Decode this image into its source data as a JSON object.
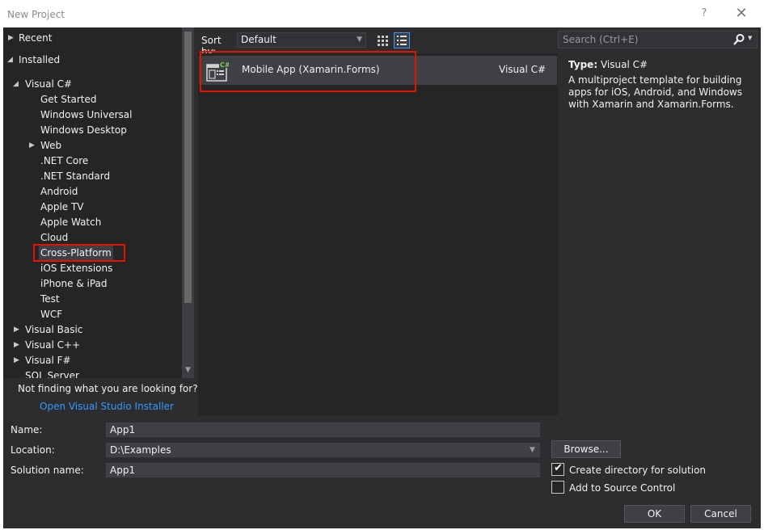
{
  "window": {
    "title": "New Project",
    "help_glyph": "?",
    "close_glyph": "✕"
  },
  "tree": {
    "recent": "Recent",
    "installed": "Installed",
    "visual_csharp": "Visual C#",
    "children": [
      "Get Started",
      "Windows Universal",
      "Windows Desktop",
      "Web",
      ".NET Core",
      ".NET Standard",
      "Android",
      "Apple TV",
      "Apple Watch",
      "Cloud",
      "Cross-Platform",
      "iOS Extensions",
      "iPhone & iPad",
      "Test",
      "WCF"
    ],
    "visual_basic": "Visual Basic",
    "visual_cpp": "Visual C++",
    "visual_fsharp": "Visual F#",
    "sql_server": "SQL Server",
    "selected": "Cross-Platform"
  },
  "help": {
    "not_finding": "Not finding what you are looking for?",
    "installer_link": "Open Visual Studio Installer"
  },
  "sort": {
    "label": "Sort by:",
    "value": "Default"
  },
  "templates": [
    {
      "name": "Mobile App (Xamarin.Forms)",
      "language": "Visual C#"
    }
  ],
  "search": {
    "placeholder": "Search (Ctrl+E)"
  },
  "details": {
    "type_label": "Type:",
    "type_value": "Visual C#",
    "description": "A multiproject template for building apps for iOS, Android, and Windows with Xamarin and Xamarin.Forms."
  },
  "form": {
    "name_label": "Name:",
    "name_value": "App1",
    "location_label": "Location:",
    "location_value": "D:\\Examples",
    "solution_label": "Solution name:",
    "solution_value": "App1",
    "browse": "Browse...",
    "create_dir": "Create directory for solution",
    "create_dir_checked": true,
    "source_control": "Add to Source Control",
    "source_control_checked": false,
    "ok": "OK",
    "cancel": "Cancel"
  },
  "colors": {
    "accent": "#3399ff",
    "highlight": "#e51400",
    "background": "#2d2d30",
    "panel": "#252526"
  }
}
